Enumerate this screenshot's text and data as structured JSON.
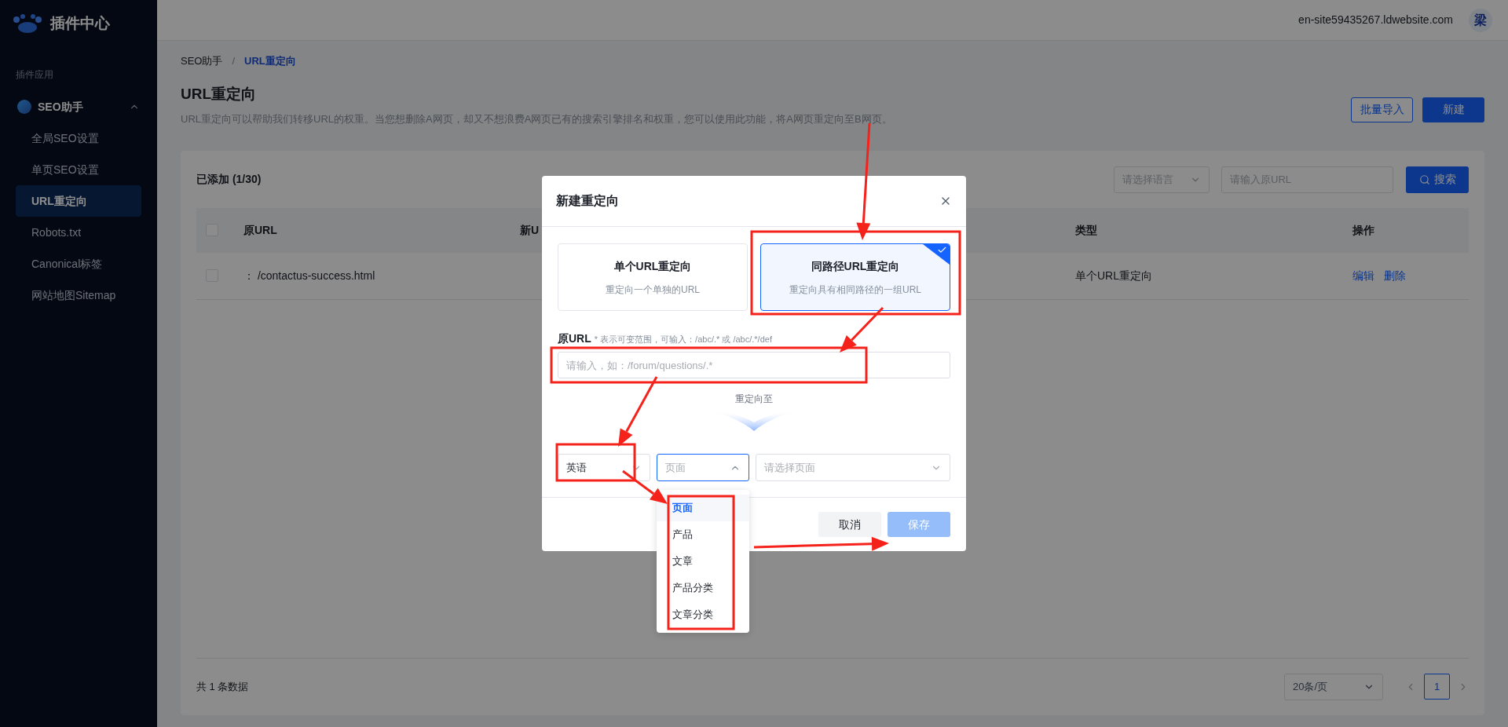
{
  "sidebar": {
    "logo": "插件中心",
    "section": "插件应用",
    "group": {
      "label": "SEO助手",
      "expanded": true,
      "items": [
        {
          "label": "全局SEO设置",
          "selected": false
        },
        {
          "label": "单页SEO设置",
          "selected": false
        },
        {
          "label": "URL重定向",
          "selected": true
        },
        {
          "label": "Robots.txt",
          "selected": false
        },
        {
          "label": "Canonical标签",
          "selected": false
        },
        {
          "label": "网站地图Sitemap",
          "selected": false
        }
      ]
    }
  },
  "header": {
    "site": "en-site59435267.ldwebsite.com",
    "avatar": "梁"
  },
  "breadcrumb": [
    {
      "label": "SEO助手",
      "current": false
    },
    {
      "label": "URL重定向",
      "current": true
    }
  ],
  "breadcrumb_separator": "/",
  "page": {
    "title": "URL重定向",
    "description": "URL重定向可以帮助我们转移URL的权重。当您想删除A网页，却又不想浪费A网页已有的搜索引擎排名和权重，您可以使用此功能，将A网页重定向至B网页。",
    "buttons": [
      {
        "label": "批量导入",
        "kind": "outline"
      },
      {
        "label": "新建",
        "kind": "primary"
      }
    ]
  },
  "list": {
    "count": "已添加 (1/30)",
    "language_placeholder": "请选择语言",
    "url_placeholder": "请输入原URL",
    "search": "搜索",
    "header_checked": false,
    "columns": [
      "原URL",
      "新U",
      "类型",
      "操作"
    ],
    "rows": [
      {
        "checked": false,
        "source": "： /contactus-success.html",
        "type": "单个URL重定向",
        "actions": [
          "编辑",
          "删除"
        ]
      }
    ],
    "total": "共 1 条数据",
    "page_size": "20条/页",
    "pages": [
      {
        "label": "1",
        "selected": true
      }
    ]
  },
  "dialog": {
    "title": "新建重定向",
    "modes": [
      {
        "title": "单个URL重定向",
        "description": "重定向一个单独的URL",
        "selected": false
      },
      {
        "title": "同路径URL重定向",
        "description": "重定向具有相同路径的一组URL",
        "selected": true
      }
    ],
    "source_label": "原URL",
    "source_hint": "* 表示可变范围，可输入：/abc/.* 或 /abc/.*/def",
    "source_placeholder": "请输入，如：/forum/questions/.*",
    "divider_label": "重定向至",
    "language": "英语",
    "target_type": {
      "value": "页面",
      "open": true,
      "options": [
        {
          "label": "页面",
          "selected": true
        },
        {
          "label": "产品",
          "selected": false
        },
        {
          "label": "文章",
          "selected": false
        },
        {
          "label": "产品分类",
          "selected": false
        },
        {
          "label": "文章分类",
          "selected": false
        }
      ]
    },
    "target_placeholder": "请选择页面",
    "buttons": [
      {
        "label": "取消",
        "kind": "secondary",
        "disabled": false
      },
      {
        "label": "保存",
        "kind": "primary",
        "disabled": true
      }
    ]
  }
}
